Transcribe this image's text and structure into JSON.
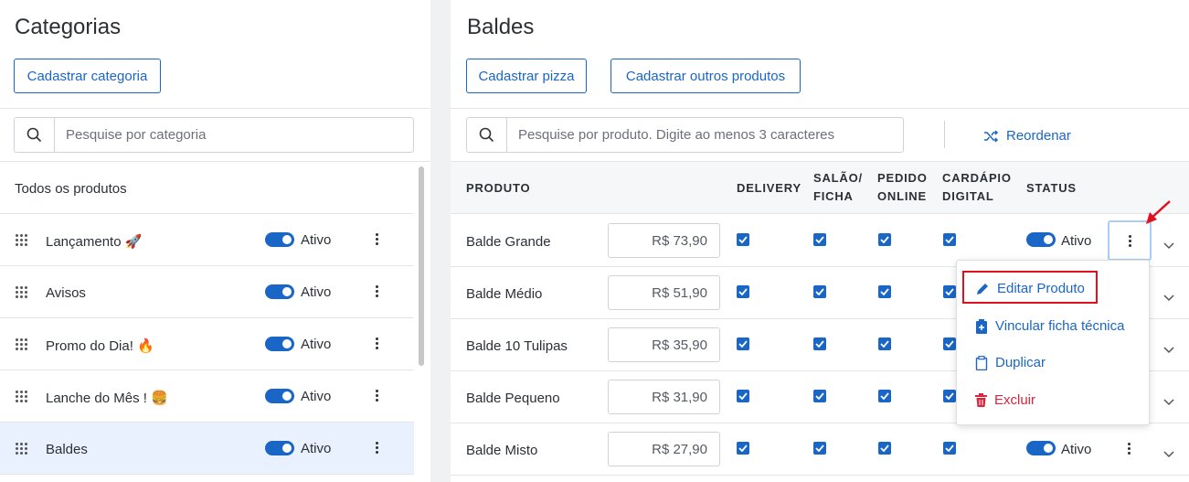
{
  "left": {
    "title": "Categorias",
    "add_button": "Cadastrar categoria",
    "search_placeholder": "Pesquise por categoria",
    "all_products": "Todos os produtos",
    "categories": [
      {
        "name": "Lançamento 🚀",
        "status": "Ativo"
      },
      {
        "name": "Avisos",
        "status": "Ativo"
      },
      {
        "name": "Promo do Dia! 🔥",
        "status": "Ativo"
      },
      {
        "name": "Lanche do Mês ! 🍔",
        "status": "Ativo"
      },
      {
        "name": "Baldes",
        "status": "Ativo",
        "selected": true
      }
    ]
  },
  "right": {
    "title": "Baldes",
    "btn_pizza": "Cadastrar pizza",
    "btn_outros": "Cadastrar outros produtos",
    "search_placeholder": "Pesquise por produto. Digite ao menos 3 caracteres",
    "reorder": "Reordenar",
    "headers": {
      "produto": "PRODUTO",
      "delivery": "DELIVERY",
      "salao": "SALÃO/ FICHA",
      "pedido": "PEDIDO ONLINE",
      "cardapio": "CARDÁPIO DIGITAL",
      "status": "STATUS"
    },
    "products": [
      {
        "name": "Balde Grande",
        "price": "R$ 73,90",
        "status": "Ativo"
      },
      {
        "name": "Balde Médio",
        "price": "R$ 51,90"
      },
      {
        "name": "Balde 10 Tulipas",
        "price": "R$ 35,90"
      },
      {
        "name": "Balde Pequeno",
        "price": "R$ 31,90"
      },
      {
        "name": "Balde Misto",
        "price": "R$ 27,90",
        "status": "Ativo"
      }
    ],
    "menu": {
      "edit": "Editar Produto",
      "link": "Vincular ficha técnica",
      "dup": "Duplicar",
      "del": "Excluir"
    }
  },
  "colors": {
    "accent": "#1a66c6",
    "danger": "#d7263d",
    "highlight": "#e0101e"
  }
}
